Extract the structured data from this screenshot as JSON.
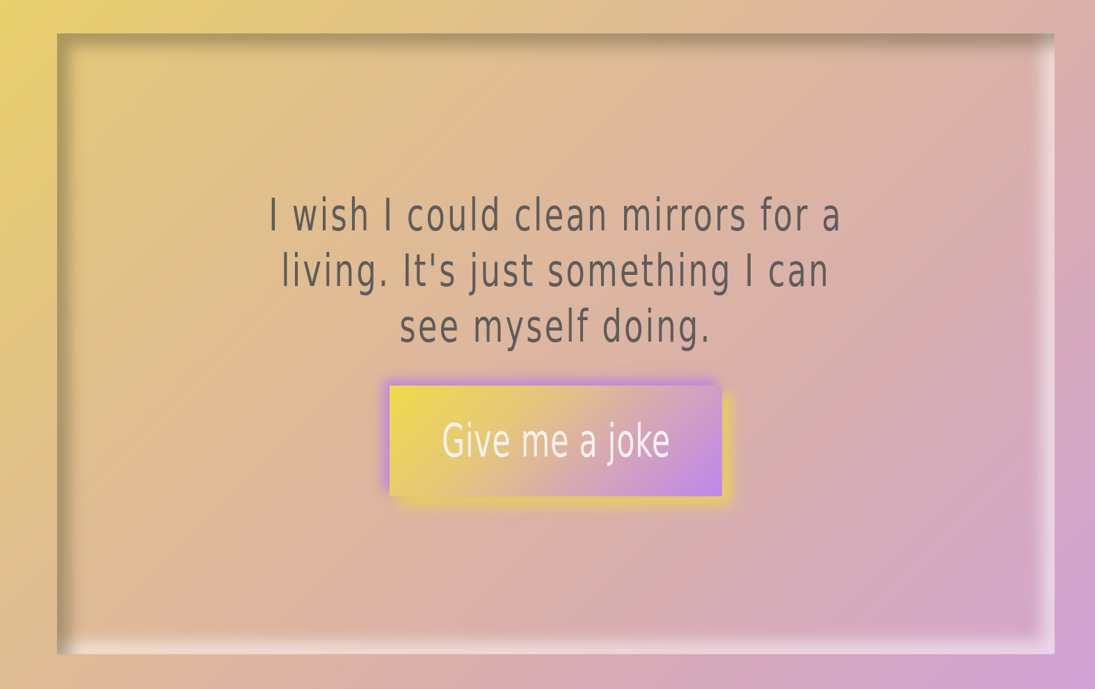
{
  "joke": {
    "text": "I wish I could clean mirrors for a living. It's just something I can see myself doing."
  },
  "button": {
    "label": "Give me a joke"
  },
  "colors": {
    "text": "#5e5c5b",
    "button_text": "#f5f2ef",
    "gradient_start": "#e9d06c",
    "gradient_end": "#d1a2d6",
    "button_gradient_start": "#f0da4a",
    "button_gradient_end": "#bf86ec"
  }
}
